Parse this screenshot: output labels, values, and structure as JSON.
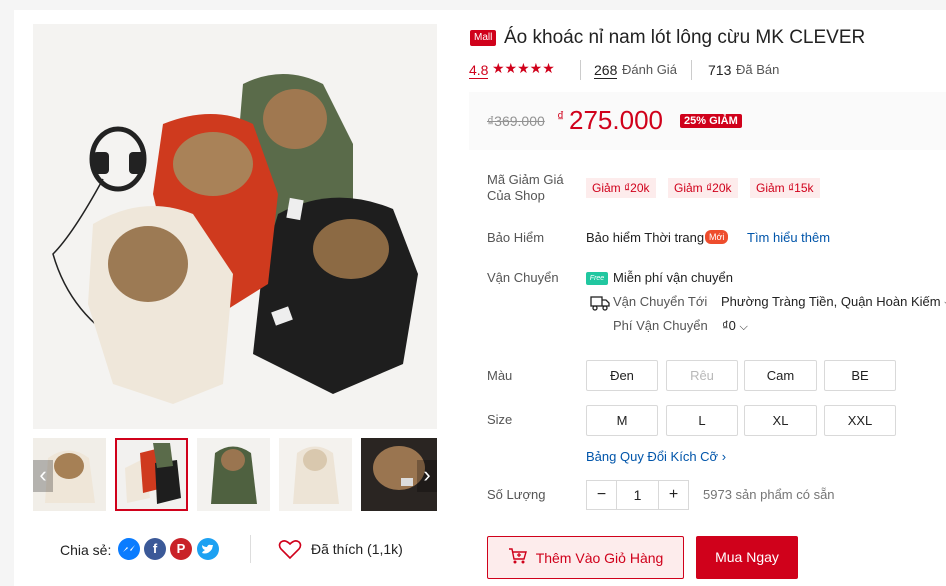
{
  "product": {
    "mall_badge": "Mall",
    "title": "Áo khoác nỉ nam lót lông cừu MK CLEVER",
    "rating": "4.8",
    "stars": "★★★★★",
    "review_count": "268",
    "review_label": "Đánh Giá",
    "sold_count": "713",
    "sold_label": "Đã Bán"
  },
  "price": {
    "original": "₫369.000",
    "currency": "₫",
    "current": "275.000",
    "discount": "25% GIẢM"
  },
  "vouchers": {
    "label_line1": "Mã Giảm Giá",
    "label_line2": "Của Shop",
    "items": [
      "Giảm ₫20k",
      "Giảm ₫20k",
      "Giảm ₫15k"
    ]
  },
  "insurance": {
    "label": "Bảo Hiểm",
    "text": "Bảo hiểm Thời trang",
    "new_badge": "Mới",
    "link": "Tìm hiểu thêm"
  },
  "shipping": {
    "label": "Vận Chuyển",
    "free_icon": "Free",
    "free_text": "Miễn phí vận chuyển",
    "to_label": "Vận Chuyển Tới",
    "to_value": "Phường Tràng Tiền, Quận Hoàn Kiếm",
    "fee_label": "Phí Vận Chuyển",
    "fee_value": "₫0"
  },
  "color": {
    "label": "Màu",
    "options": [
      "Đen",
      "Rêu",
      "Cam",
      "BE"
    ]
  },
  "size": {
    "label": "Size",
    "options": [
      "M",
      "L",
      "XL",
      "XXL"
    ],
    "chart_link": "Bảng Quy Đổi Kích Cỡ"
  },
  "quantity": {
    "label": "Số Lượng",
    "minus": "−",
    "value": "1",
    "plus": "+",
    "stock": "5973 sản phẩm có sẵn"
  },
  "actions": {
    "add_to_cart": "Thêm Vào Giỏ Hàng",
    "buy_now": "Mua Ngay"
  },
  "share": {
    "label": "Chia sẻ:",
    "icons": [
      "messenger-icon",
      "facebook-icon",
      "pinterest-icon",
      "twitter-icon"
    ],
    "liked": "Đã thích (1,1k)"
  },
  "colors": {
    "brand": "#d0011b",
    "link": "#0055aa"
  }
}
